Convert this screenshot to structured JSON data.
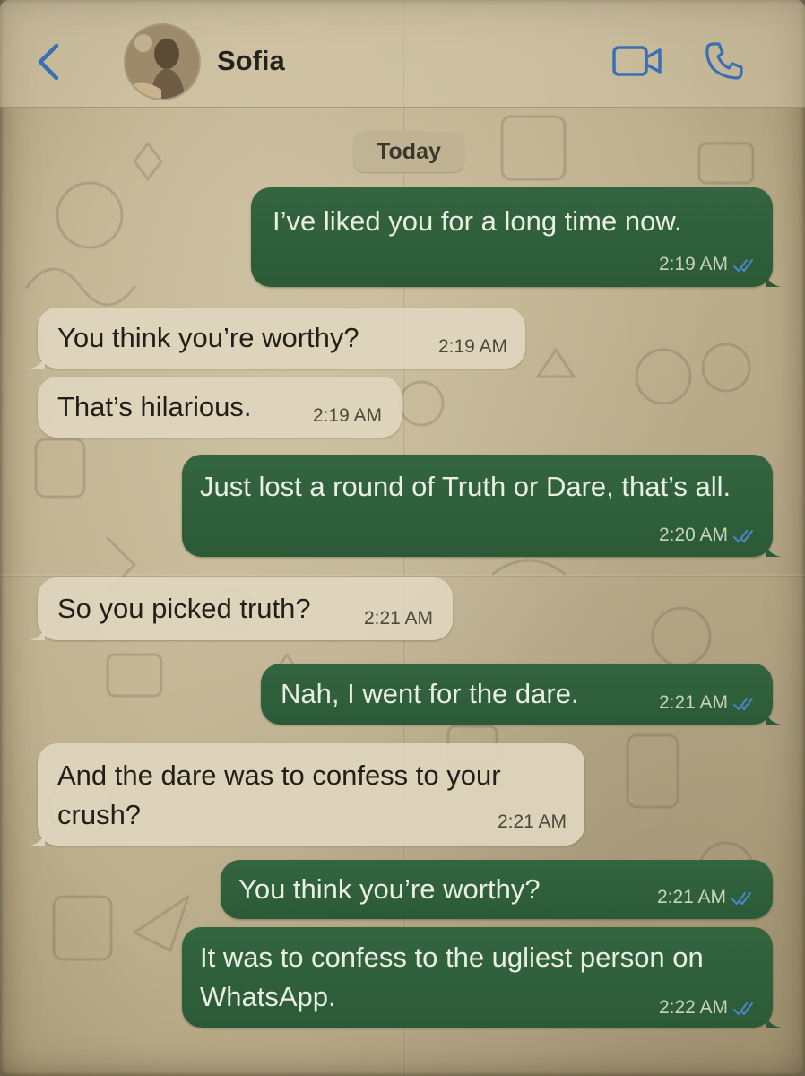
{
  "header": {
    "contact_name": "Sofia",
    "back_icon": "chevron-left-icon",
    "video_icon": "video-camera-icon",
    "call_icon": "phone-icon",
    "accent_color": "#3a6fb3"
  },
  "chat": {
    "date_label": "Today",
    "messages": [
      {
        "direction": "outgoing",
        "text": "I’ve liked you for a long time now.",
        "time": "2:19 AM",
        "status": "read"
      },
      {
        "direction": "incoming",
        "text": "You think you’re worthy?",
        "time": "2:19 AM"
      },
      {
        "direction": "incoming",
        "text": "That’s hilarious.",
        "time": "2:19 AM"
      },
      {
        "direction": "outgoing",
        "text": "Just lost a round of Truth or Dare, that’s all.",
        "time": "2:20 AM",
        "status": "read"
      },
      {
        "direction": "incoming",
        "text": "So you picked truth?",
        "time": "2:21 AM"
      },
      {
        "direction": "outgoing",
        "text": "Nah, I went for the dare.",
        "time": "2:21 AM",
        "status": "read"
      },
      {
        "direction": "incoming",
        "text": "And the dare was to confess to your crush?",
        "time": "2:21 AM"
      },
      {
        "direction": "outgoing",
        "text": "You think you’re worthy?",
        "time": "2:21 AM",
        "status": "read"
      },
      {
        "direction": "outgoing",
        "text": "It was to confess to the ugliest person on WhatsApp.",
        "time": "2:22 AM",
        "status": "read"
      }
    ]
  },
  "colors": {
    "outgoing_bubble": "#2f5f3c",
    "incoming_bubble": "#dfd6be",
    "read_ticks": "#4a86c9",
    "background": "#c3b692"
  }
}
